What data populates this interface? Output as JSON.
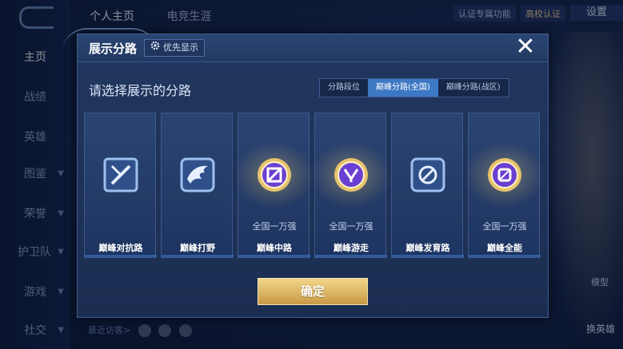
{
  "background": {
    "nav_items": [
      {
        "label": "主页",
        "active": true
      },
      {
        "label": "战绩",
        "active": false
      },
      {
        "label": "英雄",
        "active": false
      },
      {
        "label": "图鉴",
        "active": false
      },
      {
        "label": "荣誉",
        "active": false
      },
      {
        "label": "护卫队",
        "active": false
      },
      {
        "label": "游戏",
        "active": false
      },
      {
        "label": "社交",
        "active": false
      }
    ],
    "top_tabs": [
      "个人主页",
      "电竞生涯"
    ],
    "top_right": {
      "verify_text": "认证专属功能",
      "school_badge": "高校认证",
      "settings": "设置"
    },
    "model_label": "模型",
    "swap_hero_label": "换英雄",
    "recent_visitors": "最近访客>"
  },
  "modal": {
    "title": "展示分路",
    "priority_label": "优先显示",
    "close_icon": "✕",
    "section_title": "请选择展示的分路",
    "segments": [
      {
        "label": "分路段位",
        "active": false
      },
      {
        "label": "巅峰分路(全国)",
        "active": true
      },
      {
        "label": "巅峰分路(战区)",
        "active": false
      }
    ],
    "cards": [
      {
        "name": "巅峰对抗路",
        "rank": "",
        "icon": "swords-icon",
        "gold": false
      },
      {
        "name": "巅峰打野",
        "rank": "",
        "icon": "dragon-icon",
        "gold": false
      },
      {
        "name": "巅峰中路",
        "rank": "全国一万强",
        "icon": "mid-lane-icon",
        "gold": true
      },
      {
        "name": "巅峰游走",
        "rank": "全国一万强",
        "icon": "support-icon",
        "gold": true
      },
      {
        "name": "巅峰发育路",
        "rank": "",
        "icon": "farm-lane-icon",
        "gold": false
      },
      {
        "name": "巅峰全能",
        "rank": "全国一万强",
        "icon": "all-round-icon",
        "gold": true
      }
    ],
    "confirm_label": "确定"
  },
  "colors": {
    "accent_blue": "#3d78c4",
    "gold": "#e6c36b",
    "purple": "#6a3fd1"
  }
}
